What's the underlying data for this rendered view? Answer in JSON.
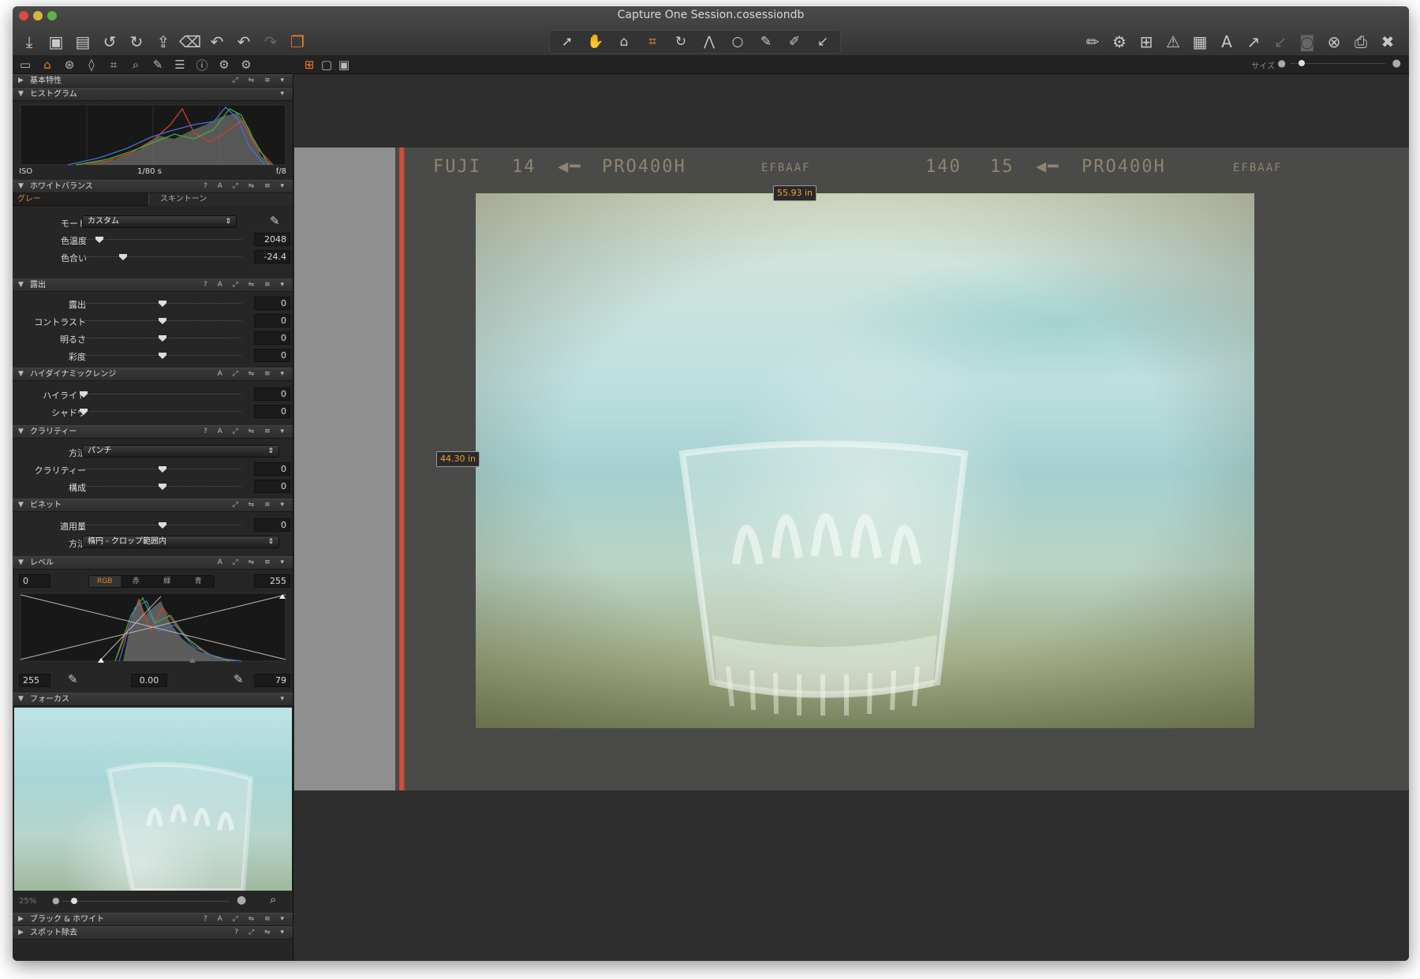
{
  "window": {
    "title": "Capture One Session.cosessiondb"
  },
  "toolbar": {
    "left_icons": [
      "import-icon",
      "capture-icon",
      "capture-alt-icon",
      "rotate-left-icon",
      "rotate-right-icon",
      "move-to-icon",
      "trash-icon",
      "undo-icon",
      "undo2-icon",
      "redo-icon",
      "copy-variants-icon"
    ],
    "cursor_tools": [
      "select-icon",
      "hand-icon",
      "loupe-icon",
      "crop-icon",
      "rotate-tool-icon",
      "keystone-icon",
      "spot-icon",
      "brush-icon",
      "erase-icon",
      "pick-icon"
    ],
    "right_icons": [
      "brush-settings-icon",
      "settings-icon",
      "grid-view-icon",
      "warning-icon",
      "overlay-grid-icon",
      "text-icon",
      "copy-adjust-icon",
      "apply-adjust-icon",
      "camera-icon",
      "cancel-icon",
      "print-icon",
      "tools-icon"
    ]
  },
  "strip": {
    "tool_tabs": [
      "library-tab",
      "adjust-tab",
      "color-tab",
      "lens-tab",
      "composition-tab",
      "focus-tab",
      "local-tab",
      "output-tab",
      "metadata-tab",
      "settings-tab",
      "batch-tab"
    ],
    "size_label": "サイズ"
  },
  "panels": {
    "basic": {
      "title": "基本特性"
    },
    "histogram": {
      "title": "ヒストグラム",
      "iso": "ISO",
      "shutter": "1/80 s",
      "aperture": "f/8"
    },
    "wb": {
      "title": "ホワイトバランス",
      "ctl": "? A ⤢ ⇋ ≡ ▾",
      "tab_gray": "グレー",
      "tab_skin": "スキントーン",
      "mode_label": "モード",
      "mode_value": "カスタム",
      "temp_label": "色温度",
      "temp_value": "2048",
      "tint_label": "色合い",
      "tint_value": "-24.4",
      "temp_pos": 0.1,
      "tint_pos": 0.25
    },
    "exposure": {
      "title": "露出",
      "ctl": "? A ⤢ ⇋ ≡ ▾",
      "rows": [
        {
          "label": "露出",
          "value": "0",
          "pos": 0.5
        },
        {
          "label": "コントラスト",
          "value": "0",
          "pos": 0.5
        },
        {
          "label": "明るさ",
          "value": "0",
          "pos": 0.5
        },
        {
          "label": "彩度",
          "value": "0",
          "pos": 0.5
        }
      ]
    },
    "hdr": {
      "title": "ハイダイナミックレンジ",
      "ctl": "A ⤢ ⇋ ≡ ▾",
      "rows": [
        {
          "label": "ハイライト",
          "value": "0",
          "pos": 0.0
        },
        {
          "label": "シャドウ",
          "value": "0",
          "pos": 0.0
        }
      ]
    },
    "clarity": {
      "title": "クラリティー",
      "ctl": "? A ⤢ ⇋ ≡ ▾",
      "method_label": "方法",
      "method_value": "パンチ",
      "rows": [
        {
          "label": "クラリティー",
          "value": "0",
          "pos": 0.5
        },
        {
          "label": "構成",
          "value": "0",
          "pos": 0.5
        }
      ]
    },
    "vignette": {
      "title": "ビネット",
      "ctl": "⤢ ⇋ ≡ ▾",
      "amount_label": "適用量",
      "amount_value": "0",
      "amount_pos": 0.5,
      "method_label": "方法",
      "method_value": "楕円 - クロップ範囲内"
    },
    "levels": {
      "title": "レベル",
      "ctl": "A ⤢ ⇋ ≡ ▾",
      "in_low": "0",
      "in_high": "255",
      "channels": [
        "RGB",
        "赤",
        "緑",
        "青"
      ],
      "out_low": "255",
      "mid": "0.00",
      "out_high": "79"
    },
    "focus": {
      "title": "フォーカス",
      "zoom": "25%"
    },
    "bw": {
      "title": "ブラック & ホワイト",
      "ctl": "? A ⤢ ⇋ ≡ ▾"
    },
    "spot": {
      "title": "スポット除去",
      "ctl": "? ⤢ ⇋ ▾"
    }
  },
  "viewer": {
    "edge_texts": [
      "FUJI",
      "14",
      "PRO400H",
      "EFBAAF",
      "140",
      "15",
      "PRO400H",
      "EFBAAF"
    ],
    "width_label": "55.93 in",
    "height_label": "44.30 in"
  },
  "colors": {
    "accent": "#e8812a",
    "bg": "#2b2b2b",
    "panel": "#262626"
  }
}
